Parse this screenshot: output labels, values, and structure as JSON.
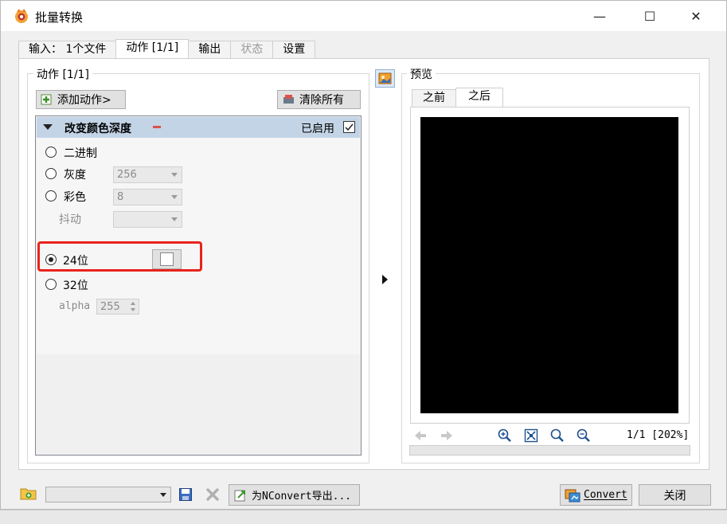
{
  "window": {
    "title": "批量转换",
    "minimize_glyph": "—",
    "maximize_glyph": "☐",
    "close_glyph": "✕"
  },
  "tabs": [
    {
      "label": "输入： 1个文件",
      "state": "normal"
    },
    {
      "label": "动作 [1/1]",
      "state": "active"
    },
    {
      "label": "输出",
      "state": "normal"
    },
    {
      "label": "状态",
      "state": "disabled"
    },
    {
      "label": "设置",
      "state": "normal"
    }
  ],
  "actions_group": {
    "title": "动作 [1/1]",
    "add_button": "添加动作>",
    "clear_button": "清除所有",
    "action": {
      "name": "改变颜色深度",
      "enabled_label": "已启用",
      "enabled": true,
      "options": {
        "binary": "二进制",
        "grayscale": "灰度",
        "grayscale_value": "256",
        "color": "彩色",
        "color_value": "8",
        "dither": "抖动",
        "dither_value": "",
        "bit24": "24位",
        "bit32": "32位",
        "alpha_label": "alpha",
        "alpha_value": "255"
      },
      "selected": "24位"
    }
  },
  "preview": {
    "title": "预览",
    "tabs": [
      {
        "label": "之前",
        "active": false
      },
      {
        "label": "之后",
        "active": true
      }
    ],
    "status": "1/1 [202%]"
  },
  "footer": {
    "path_value": "",
    "export_button": "为NConvert导出...",
    "convert_button": "Convert",
    "close_button": "关闭"
  },
  "colors": {
    "highlight": "#e8231c",
    "action_header": "#c3d4e6",
    "preview_bg": "#000000"
  }
}
